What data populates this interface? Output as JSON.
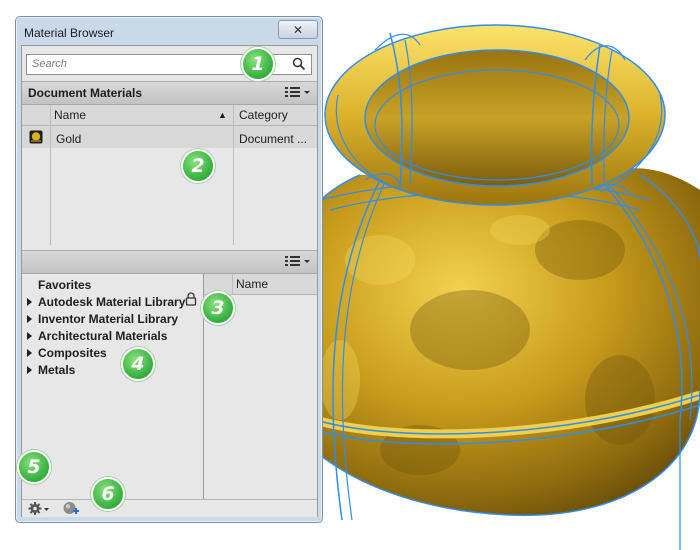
{
  "window": {
    "title": "Material Browser",
    "close_glyph": "✕"
  },
  "search": {
    "placeholder": "Search"
  },
  "document_materials": {
    "header": "Document Materials",
    "columns": [
      "Name",
      "Category"
    ],
    "sort_glyph": "▲",
    "rows": [
      {
        "name": "Gold",
        "category": "Document ..."
      }
    ]
  },
  "library": {
    "tree": [
      {
        "label": "Favorites",
        "expandable": false,
        "locked": false
      },
      {
        "label": "Autodesk Material Library",
        "expandable": true,
        "locked": true
      },
      {
        "label": "Inventor Material Library",
        "expandable": true,
        "locked": false
      },
      {
        "label": "Architectural Materials",
        "expandable": true,
        "locked": false
      },
      {
        "label": "Composites",
        "expandable": true,
        "locked": false
      },
      {
        "label": "Metals",
        "expandable": true,
        "locked": false
      }
    ],
    "list_column": "Name"
  },
  "callouts": [
    "1",
    "2",
    "3",
    "4",
    "5",
    "6"
  ],
  "icons": [
    "search-icon",
    "view-options-icon",
    "gold-material-swatch-icon",
    "lock-icon",
    "settings-gear-icon",
    "create-material-icon"
  ],
  "colors": {
    "gold": "#d8b02a",
    "edge_highlight": "#2f8df0",
    "callout_green": "#3cb543"
  }
}
